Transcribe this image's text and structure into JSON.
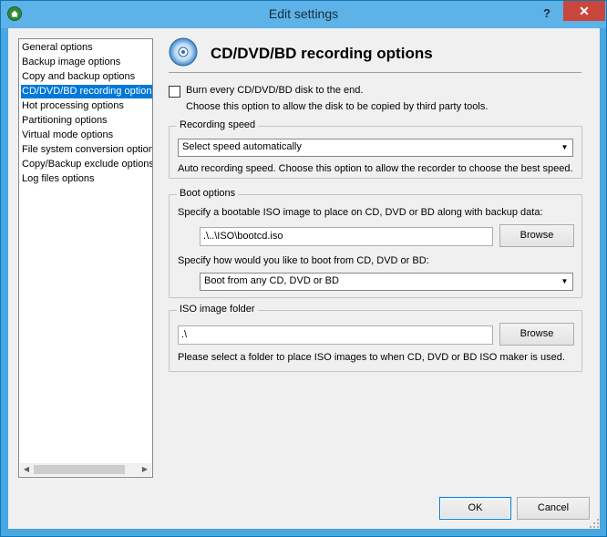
{
  "window": {
    "title": "Edit settings",
    "help_glyph": "?",
    "close_glyph": "✕"
  },
  "nav": {
    "items": [
      {
        "label": "General options"
      },
      {
        "label": "Backup image options"
      },
      {
        "label": "Copy and backup options"
      },
      {
        "label": "CD/DVD/BD recording options"
      },
      {
        "label": "Hot processing options"
      },
      {
        "label": "Partitioning options"
      },
      {
        "label": "Virtual mode options"
      },
      {
        "label": "File system conversion options"
      },
      {
        "label": "Copy/Backup exclude options"
      },
      {
        "label": "Log files options"
      }
    ],
    "selected_label": "CD/DVD/BD recording options"
  },
  "panel": {
    "title": "CD/DVD/BD recording options",
    "burn_checkbox": {
      "label": "Burn every CD/DVD/BD disk to the end.",
      "checked": false,
      "hint": "Choose this option to allow the disk to be copied by third party tools."
    },
    "recording_speed": {
      "legend": "Recording speed",
      "selected": "Select speed automatically",
      "hint": "Auto recording speed. Choose this option to allow the recorder to choose the best speed."
    },
    "boot_options": {
      "legend": "Boot options",
      "iso_prompt": "Specify a bootable ISO image to place on CD, DVD or BD along with backup data:",
      "iso_path": ".\\..\\ISO\\bootcd.iso",
      "browse_label": "Browse",
      "boot_prompt": "Specify how would you like to boot from CD, DVD or BD:",
      "boot_selected": "Boot from any CD, DVD or BD"
    },
    "iso_folder": {
      "legend": "ISO image folder",
      "path": ".\\",
      "browse_label": "Browse",
      "hint": "Please select a folder to place ISO images to when CD, DVD or BD ISO maker is used."
    }
  },
  "footer": {
    "ok_label": "OK",
    "cancel_label": "Cancel"
  },
  "colors": {
    "titlebar": "#5db2e7",
    "close": "#c8463b",
    "selection": "#0078d7"
  }
}
